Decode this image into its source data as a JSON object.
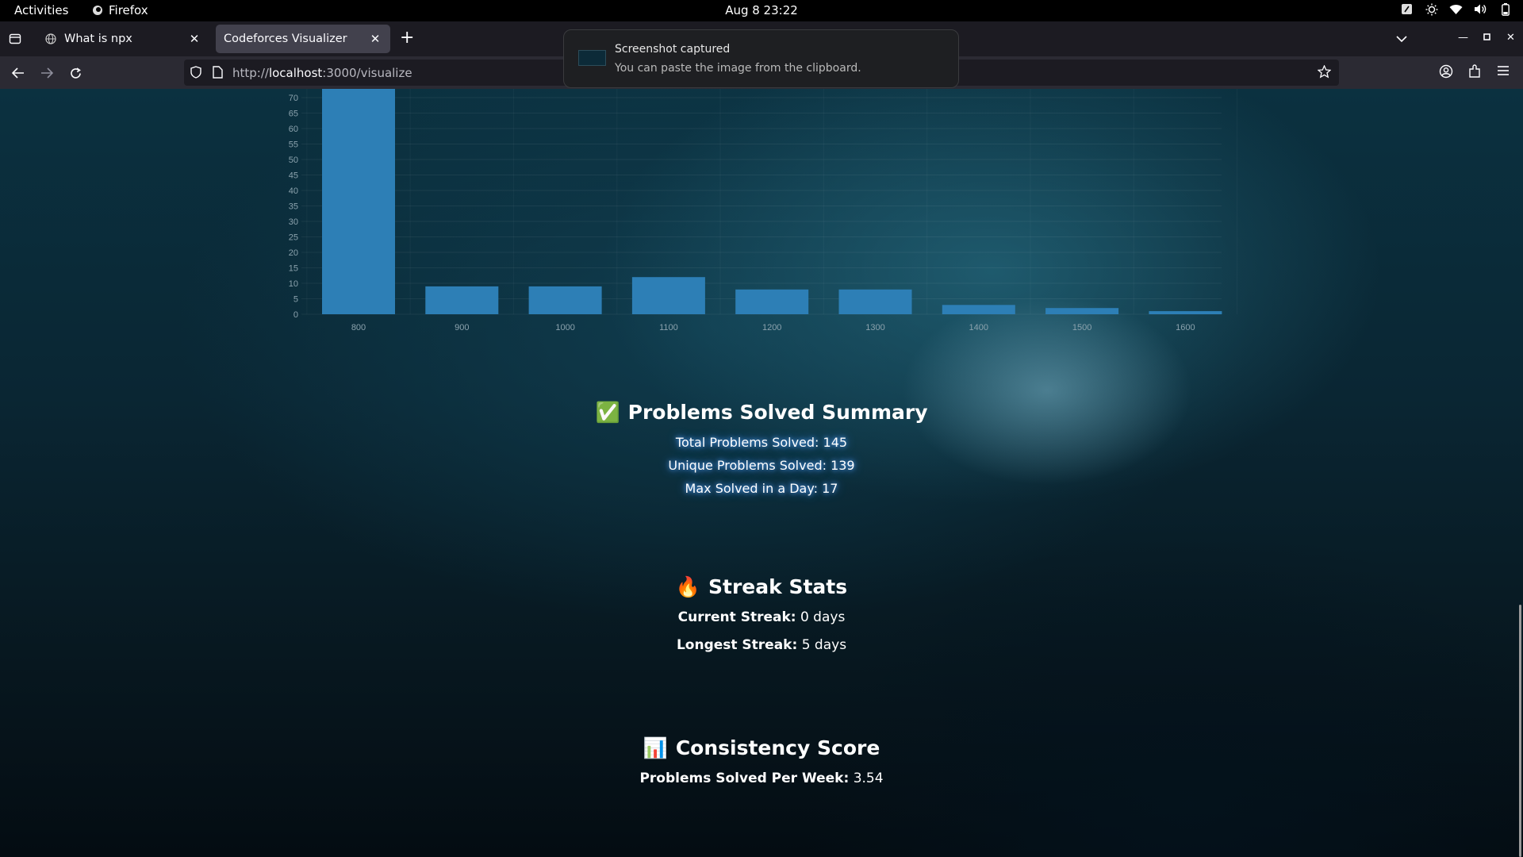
{
  "system": {
    "activities": "Activities",
    "app_name": "Firefox",
    "clock": "Aug 8  23:22"
  },
  "browser": {
    "tabs": [
      {
        "label": "What is npx"
      },
      {
        "label": "Codeforces Visualizer"
      }
    ],
    "url_prefix": "http://",
    "url_host": "localhost",
    "url_path": ":3000/visualize"
  },
  "notification": {
    "title": "Screenshot captured",
    "body": "You can paste the image from the clipboard."
  },
  "chart_data": {
    "type": "bar",
    "categories": [
      "800",
      "900",
      "1000",
      "1100",
      "1200",
      "1300",
      "1400",
      "1500",
      "1600"
    ],
    "values": [
      73,
      9,
      9,
      12,
      8,
      8,
      3,
      2,
      1
    ],
    "yticks": [
      "0",
      "5",
      "10",
      "15",
      "20",
      "25",
      "30",
      "35",
      "40",
      "45",
      "50",
      "55",
      "60",
      "65",
      "70"
    ],
    "ylim": [
      0,
      70
    ],
    "bar_color": "#2d7fb6"
  },
  "summary": {
    "emoji": "✅",
    "title": "Problems Solved Summary",
    "total": "Total Problems Solved: 145",
    "unique": "Unique Problems Solved: 139",
    "max_day": "Max Solved in a Day: 17"
  },
  "streak": {
    "emoji": "🔥",
    "title": "Streak Stats",
    "current_label": "Current Streak:",
    "current_value": " 0 days",
    "longest_label": "Longest Streak:",
    "longest_value": " 5 days"
  },
  "consistency": {
    "emoji": "📊",
    "title": "Consistency Score",
    "per_week_label": "Problems Solved Per Week:",
    "per_week_value": " 3.54"
  }
}
